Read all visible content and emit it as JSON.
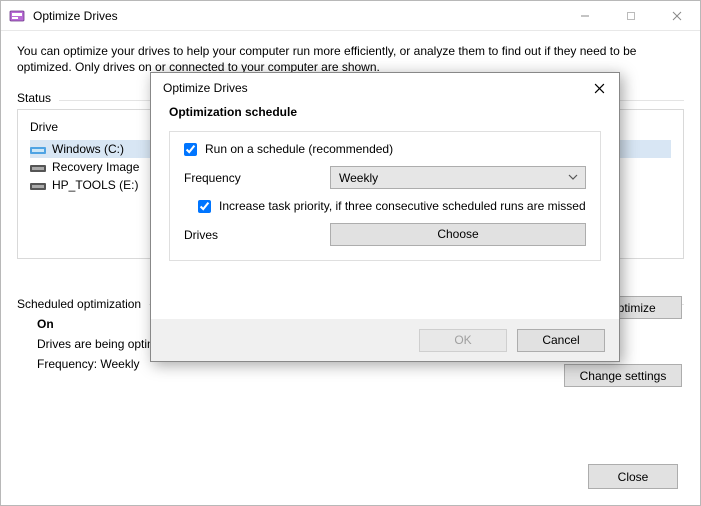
{
  "main": {
    "title": "Optimize Drives",
    "intro": "You can optimize your drives to help your computer run more efficiently, or analyze them to find out if they need to be optimized. Only drives on or connected to your computer are shown.",
    "status_label": "Status",
    "header_drive": "Drive",
    "drives": [
      {
        "label": "Windows (C:)"
      },
      {
        "label": "Recovery Image"
      },
      {
        "label": "HP_TOOLS (E:)"
      }
    ],
    "optimize_btn": "Optimize",
    "sched_label": "Scheduled optimization",
    "sched_on": "On",
    "sched_msg": "Drives are being optimized automatically.",
    "sched_freq": "Frequency: Weekly",
    "change_btn": "Change settings",
    "close_btn": "Close"
  },
  "dialog": {
    "title": "Optimize Drives",
    "heading": "Optimization schedule",
    "run_schedule_checked": true,
    "run_schedule_label": "Run on a schedule (recommended)",
    "frequency_label": "Frequency",
    "frequency_value": "Weekly",
    "increase_priority_checked": true,
    "increase_priority_label": "Increase task priority, if three consecutive scheduled runs are missed",
    "drives_label": "Drives",
    "choose_btn": "Choose",
    "ok_btn": "OK",
    "cancel_btn": "Cancel"
  }
}
